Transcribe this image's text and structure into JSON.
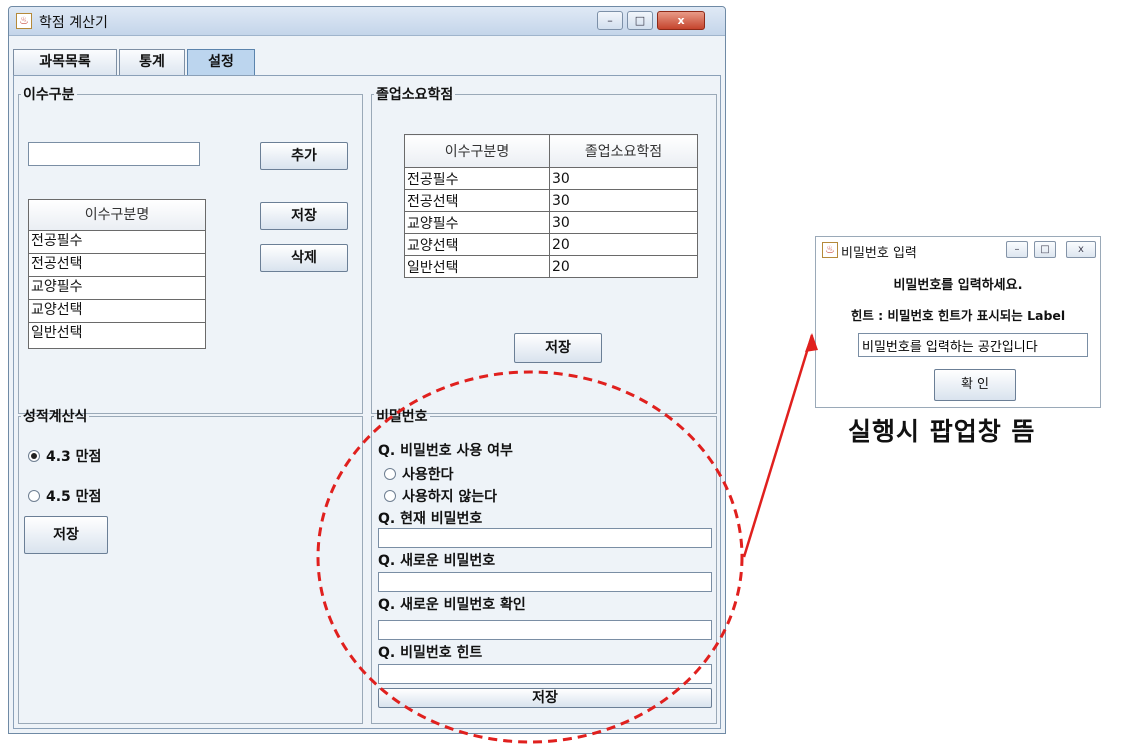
{
  "window": {
    "title": "학점 계산기",
    "controls": {
      "minimize": "–",
      "maximize": "□",
      "close": "x"
    }
  },
  "tabs": [
    {
      "label": "과목목록",
      "active": false
    },
    {
      "label": "통계",
      "active": false
    },
    {
      "label": "설정",
      "active": true
    }
  ],
  "course_type": {
    "legend": "이수구분",
    "input_value": "",
    "buttons": {
      "add": "추가",
      "save": "저장",
      "delete": "삭제"
    },
    "list_header": "이수구분명",
    "items": [
      "전공필수",
      "전공선택",
      "교양필수",
      "교양선택",
      "일반선택"
    ]
  },
  "graduation": {
    "legend": "졸업소요학점",
    "columns": [
      "이수구분명",
      "졸업소요학점"
    ],
    "rows": [
      [
        "전공필수",
        "30"
      ],
      [
        "전공선택",
        "30"
      ],
      [
        "교양필수",
        "30"
      ],
      [
        "교양선택",
        "20"
      ],
      [
        "일반선택",
        "20"
      ]
    ],
    "save": "저장"
  },
  "grade_formula": {
    "legend": "성적계산식",
    "options": [
      {
        "label": "4.3 만점",
        "selected": true
      },
      {
        "label": "4.5 만점",
        "selected": false
      }
    ],
    "save": "저장"
  },
  "password": {
    "legend": "비밀번호",
    "q_use": "Q. 비밀번호 사용 여부",
    "use_options": [
      {
        "label": "사용한다",
        "selected": false
      },
      {
        "label": "사용하지 않는다",
        "selected": false
      }
    ],
    "q_current": "Q. 현재 비밀번호",
    "q_new": "Q. 새로운 비밀번호",
    "q_confirm": "Q. 새로운 비밀번호 확인",
    "q_hint": "Q. 비밀번호 힌트",
    "save": "저장"
  },
  "popup": {
    "title": "비밀번호 입력",
    "prompt": "비밀번호를 입력하세요.",
    "hint": "힌트 : 비밀번호 힌트가 표시되는 Label",
    "input_value": "비밀번호를 입력하는 공간입니다",
    "ok": "확 인"
  },
  "annotation": "실행시 팝업창 뜸",
  "colors": {
    "annotation": "#e0201e",
    "active_tab": "#bcd5ee",
    "window_bg": "#eef3f8"
  }
}
